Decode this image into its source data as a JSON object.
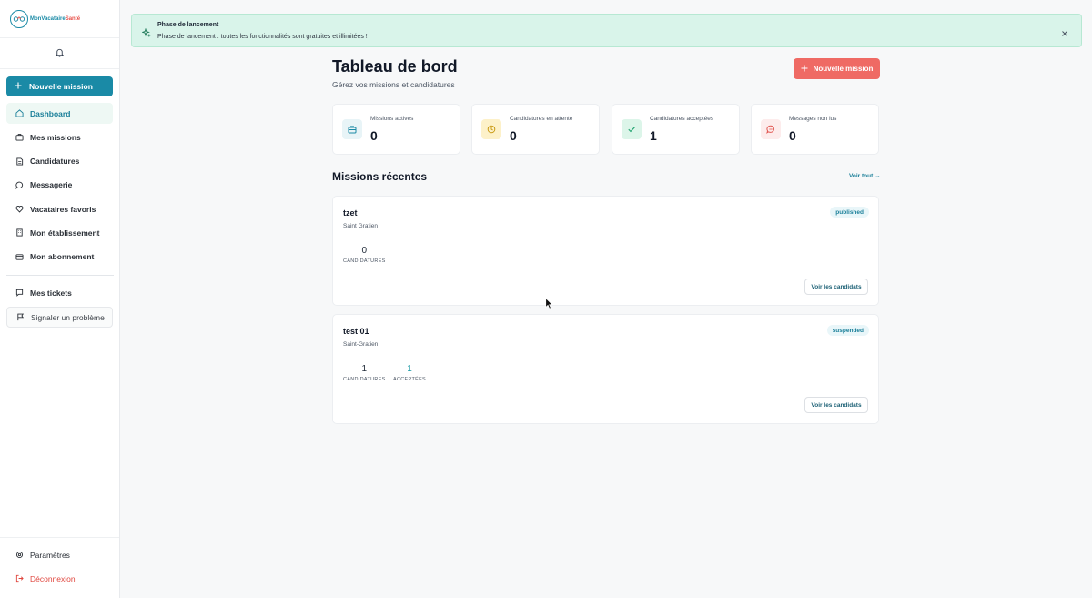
{
  "app": {
    "logo_part1": "MonVacataire",
    "logo_part2": "Santé"
  },
  "sidebar": {
    "new_mission": "Nouvelle mission",
    "items": [
      {
        "label": "Dashboard",
        "icon": "home-icon"
      },
      {
        "label": "Mes missions",
        "icon": "briefcase-icon"
      },
      {
        "label": "Candidatures",
        "icon": "document-icon"
      },
      {
        "label": "Messagerie",
        "icon": "chat-icon"
      },
      {
        "label": "Vacataires favoris",
        "icon": "heart-icon"
      },
      {
        "label": "Mon établissement",
        "icon": "building-icon"
      },
      {
        "label": "Mon abonnement",
        "icon": "card-icon"
      }
    ],
    "support": [
      {
        "label": "Mes tickets",
        "icon": "ticket-icon"
      },
      {
        "label": "Signaler un problème",
        "icon": "flag-icon"
      }
    ],
    "bottom": [
      {
        "label": "Paramètres",
        "icon": "gear-icon"
      },
      {
        "label": "Déconnexion",
        "icon": "logout-icon"
      }
    ]
  },
  "banner": {
    "title": "Phase de lancement",
    "text": "Phase de lancement : toutes les fonctionnalités sont gratuites et illimitées !"
  },
  "header": {
    "title": "Tableau de bord",
    "subtitle": "Gérez vos missions et candidatures",
    "new_mission": "Nouvelle mission"
  },
  "stats": [
    {
      "label": "Missions actives",
      "value": "0",
      "icon": "briefcase-icon",
      "color": "#1a8aa6",
      "bg": "#e8f4f7"
    },
    {
      "label": "Candidatures en attente",
      "value": "0",
      "icon": "clock-icon",
      "color": "#c99a12",
      "bg": "#fdf1c9"
    },
    {
      "label": "Candidatures acceptées",
      "value": "1",
      "icon": "check-icon",
      "color": "#2aa876",
      "bg": "#dcf5e9"
    },
    {
      "label": "Messages non lus",
      "value": "0",
      "icon": "chat-icon",
      "color": "#e25a55",
      "bg": "#fdecec"
    }
  ],
  "recent": {
    "title": "Missions récentes",
    "see_all": "Voir tout →",
    "missions": [
      {
        "title": "tzet",
        "location": "Saint Gratien",
        "status": "published",
        "applications_value": "0",
        "applications_label": "CANDIDATURES",
        "button": "Voir les candidats"
      },
      {
        "title": "test 01",
        "location": "Saint-Gratien",
        "status": "suspended",
        "applications_value": "1",
        "applications_label": "CANDIDATURES",
        "accepted_value": "1",
        "accepted_label": "ACCEPTÉES",
        "button": "Voir les candidats"
      }
    ]
  }
}
